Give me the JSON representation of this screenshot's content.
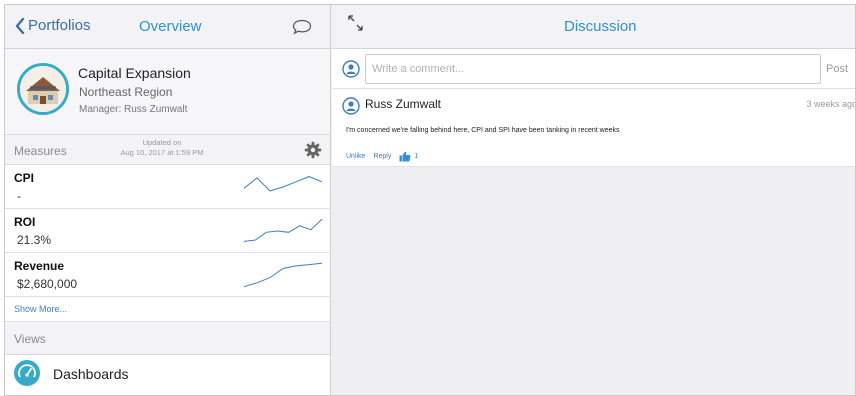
{
  "left_pane": {
    "back_label": "Portfolios",
    "title": "Overview",
    "project": {
      "name": "Capital Expansion",
      "region": "Northeast Region",
      "manager": "Manager: Russ Zumwalt"
    },
    "measures_label": "Measures",
    "updated_line1": "Updated on",
    "updated_line2": "Aug 10, 2017 at 1:59 PM",
    "measures": [
      {
        "name": "CPI",
        "value": "-",
        "trend": [
          0.45,
          0.85,
          0.35,
          0.5,
          0.7,
          0.9,
          0.7
        ]
      },
      {
        "name": "ROI",
        "value": "21.3%",
        "trend": [
          0.1,
          0.15,
          0.45,
          0.5,
          0.45,
          0.7,
          0.55,
          0.95
        ]
      },
      {
        "name": "Revenue",
        "value": "$2,680,000",
        "trend": [
          0.05,
          0.2,
          0.4,
          0.75,
          0.85,
          0.9,
          0.95
        ]
      }
    ],
    "show_more": "Show More...",
    "views_label": "Views",
    "dashboards_label": "Dashboards"
  },
  "right_pane": {
    "title": "Discussion",
    "composer": {
      "placeholder": "Write a comment...",
      "post_label": "Post"
    },
    "comment": {
      "author": "Russ Zumwalt",
      "time": "3 weeks ago",
      "text": "I'm concerned we're falling behind here, CPI and SPI have been tanking in recent weeks",
      "unlike_label": "Unlike",
      "reply_label": "Reply",
      "like_count": "1"
    }
  },
  "colors": {
    "accent": "#2f8fd8",
    "link": "#3d7dbf",
    "teal": "#37a9c9"
  },
  "icons": [
    "chevron-left-icon",
    "chat-bubble-icon",
    "gear-icon",
    "expand-icon",
    "user-icon",
    "thumbs-up-icon",
    "gauge-icon"
  ]
}
